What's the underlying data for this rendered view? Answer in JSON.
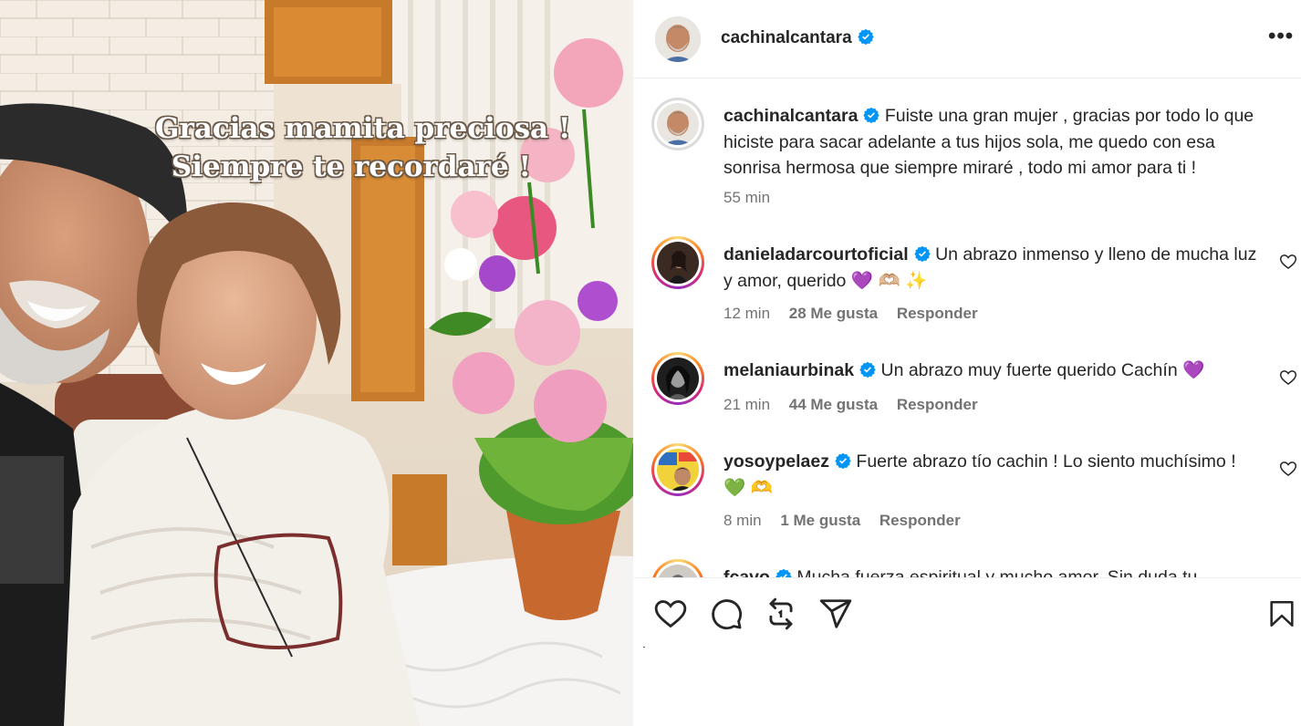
{
  "photo": {
    "overlay_line1": "Gracias mamita preciosa !",
    "overlay_line2": "Siempre te recordaré !"
  },
  "post": {
    "author": "cachinalcantara",
    "verified": true,
    "caption": "Fuiste una gran mujer , gracias por todo lo que hiciste para sacar adelante a tus hijos sola, me quedo con esa sonrisa hermosa que siempre miraré , todo mi amor para ti !",
    "time": "55 min"
  },
  "comments": [
    {
      "user": "danieladarcourtoficial",
      "text": "Un abrazo inmenso y lleno de mucha luz y amor, querido 💜 🫶🏼 ✨",
      "time": "12 min",
      "likes": "28 Me gusta",
      "reply": "Responder"
    },
    {
      "user": "melaniaurbinak",
      "text": "Un abrazo muy fuerte querido Cachín 💜",
      "time": "21 min",
      "likes": "44 Me gusta",
      "reply": "Responder"
    },
    {
      "user": "yosoypelaez",
      "text": "Fuerte abrazo tío cachin ! Lo siento muchísimo ! 💚 🫶",
      "time": "8 min",
      "likes": "1 Me gusta",
      "reply": "Responder"
    },
    {
      "user": "fcavo",
      "text": "Mucha fuerza espiritual y mucho amor. Sin duda tu"
    }
  ],
  "icons": {
    "header_more": "more-options-icon",
    "verified": "verified-badge-icon",
    "comment_like": "heart-outline-icon",
    "actions": [
      "like-icon",
      "comment-icon",
      "repost-icon",
      "share-icon",
      "save-icon"
    ]
  },
  "colors": {
    "verified": "#0095f6",
    "muted": "#737373",
    "text": "#262626"
  }
}
